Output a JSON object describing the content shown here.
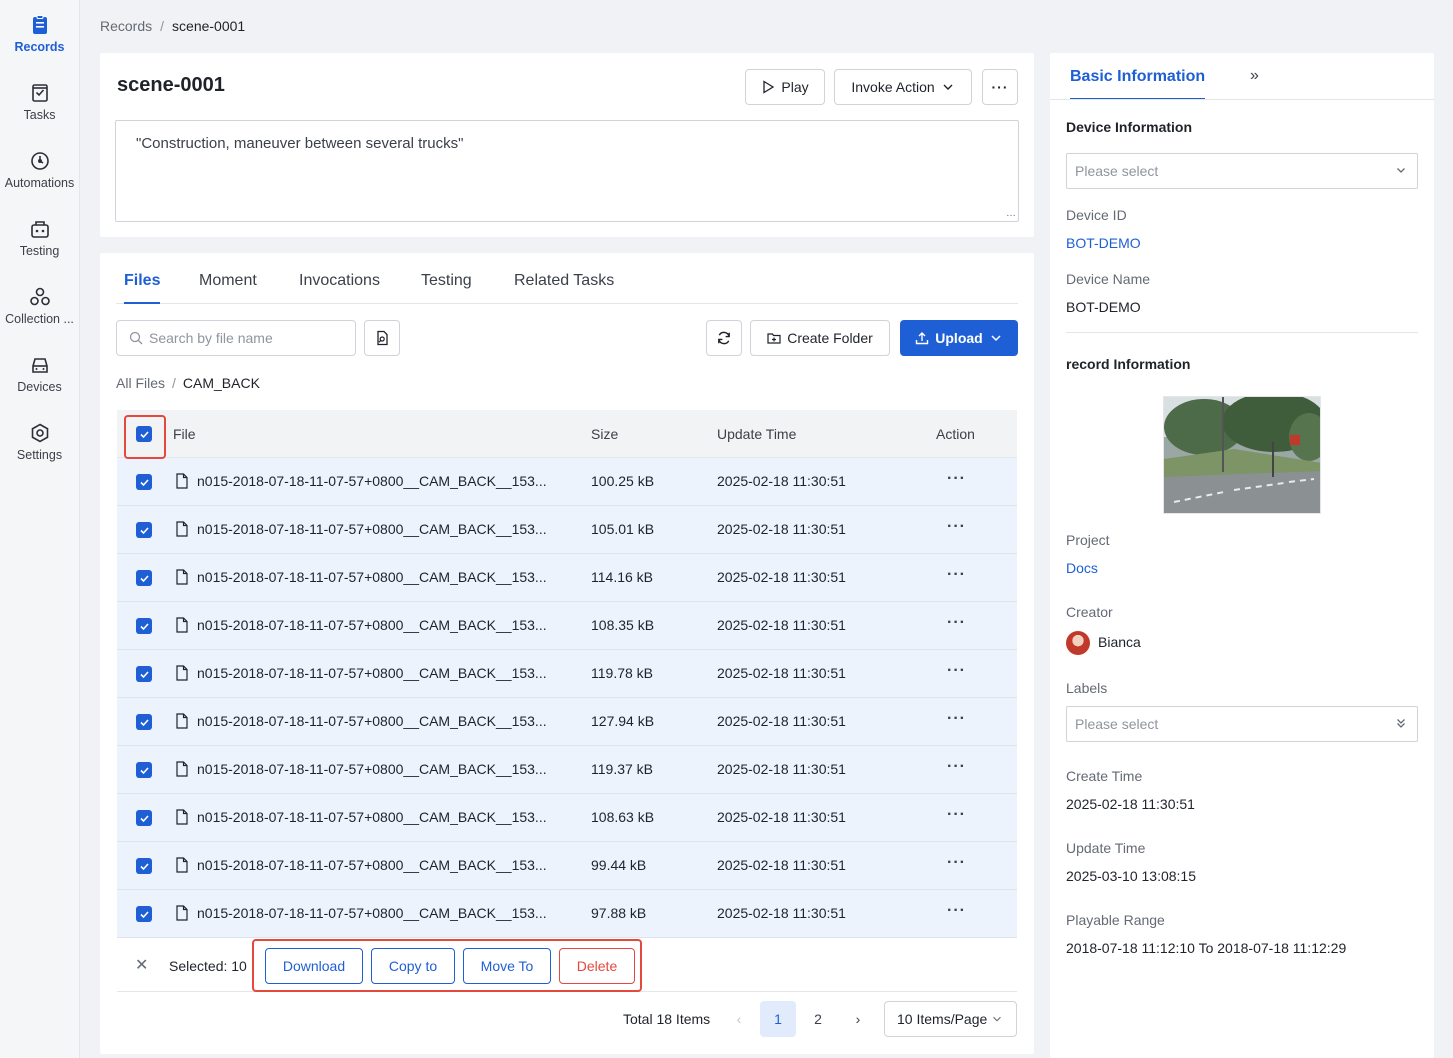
{
  "nav": [
    {
      "label": "Records",
      "icon": "records-icon",
      "active": true
    },
    {
      "label": "Tasks",
      "icon": "tasks-icon"
    },
    {
      "label": "Automations",
      "icon": "automations-icon"
    },
    {
      "label": "Testing",
      "icon": "testing-icon"
    },
    {
      "label": "Collection ...",
      "icon": "collection-icon"
    },
    {
      "label": "Devices",
      "icon": "devices-icon"
    },
    {
      "label": "Settings",
      "icon": "settings-icon"
    }
  ],
  "breadcrumb": {
    "root": "Records",
    "current": "scene-0001"
  },
  "scene": {
    "title": "scene-0001",
    "description": "\"Construction, maneuver between several trucks\"",
    "play_label": "Play",
    "invoke_label": "Invoke Action"
  },
  "tabs": [
    "Files",
    "Moment",
    "Invocations",
    "Testing",
    "Related Tasks"
  ],
  "toolbar": {
    "search_placeholder": "Search by file name",
    "create_folder_label": "Create Folder",
    "upload_label": "Upload"
  },
  "path": {
    "root": "All Files",
    "current": "CAM_BACK"
  },
  "table": {
    "headers": {
      "file": "File",
      "size": "Size",
      "update": "Update Time",
      "action": "Action"
    },
    "rows": [
      {
        "name": "n015-2018-07-18-11-07-57+0800__CAM_BACK__153...",
        "size": "100.25 kB",
        "time": "2025-02-18 11:30:51"
      },
      {
        "name": "n015-2018-07-18-11-07-57+0800__CAM_BACK__153...",
        "size": "105.01 kB",
        "time": "2025-02-18 11:30:51"
      },
      {
        "name": "n015-2018-07-18-11-07-57+0800__CAM_BACK__153...",
        "size": "114.16 kB",
        "time": "2025-02-18 11:30:51"
      },
      {
        "name": "n015-2018-07-18-11-07-57+0800__CAM_BACK__153...",
        "size": "108.35 kB",
        "time": "2025-02-18 11:30:51"
      },
      {
        "name": "n015-2018-07-18-11-07-57+0800__CAM_BACK__153...",
        "size": "119.78 kB",
        "time": "2025-02-18 11:30:51"
      },
      {
        "name": "n015-2018-07-18-11-07-57+0800__CAM_BACK__153...",
        "size": "127.94 kB",
        "time": "2025-02-18 11:30:51"
      },
      {
        "name": "n015-2018-07-18-11-07-57+0800__CAM_BACK__153...",
        "size": "119.37 kB",
        "time": "2025-02-18 11:30:51"
      },
      {
        "name": "n015-2018-07-18-11-07-57+0800__CAM_BACK__153...",
        "size": "108.63 kB",
        "time": "2025-02-18 11:30:51"
      },
      {
        "name": "n015-2018-07-18-11-07-57+0800__CAM_BACK__153...",
        "size": "99.44 kB",
        "time": "2025-02-18 11:30:51"
      },
      {
        "name": "n015-2018-07-18-11-07-57+0800__CAM_BACK__153...",
        "size": "97.88 kB",
        "time": "2025-02-18 11:30:51"
      }
    ]
  },
  "selection": {
    "text": "Selected: 10",
    "download": "Download",
    "copy": "Copy to",
    "move": "Move To",
    "delete": "Delete"
  },
  "pagination": {
    "total": "Total 18 Items",
    "pages": [
      "1",
      "2"
    ],
    "current_page": "1",
    "page_size": "10 Items/Page"
  },
  "side": {
    "tab": "Basic Information",
    "device_info_title": "Device Information",
    "device_select_placeholder": "Please select",
    "device_id_label": "Device ID",
    "device_id": "BOT-DEMO",
    "device_name_label": "Device Name",
    "device_name": "BOT-DEMO",
    "record_info_title": "record Information",
    "project_label": "Project",
    "project": "Docs",
    "creator_label": "Creator",
    "creator": "Bianca",
    "labels_label": "Labels",
    "labels_placeholder": "Please select",
    "create_time_label": "Create Time",
    "create_time": "2025-02-18 11:30:51",
    "update_time_label": "Update Time",
    "update_time": "2025-03-10 13:08:15",
    "playable_label": "Playable Range",
    "playable": "2018-07-18 11:12:10 To 2018-07-18 11:12:29"
  },
  "colors": {
    "accent": "#1f5fd6",
    "danger": "#e5483d",
    "row_selected": "#edf3fd"
  }
}
